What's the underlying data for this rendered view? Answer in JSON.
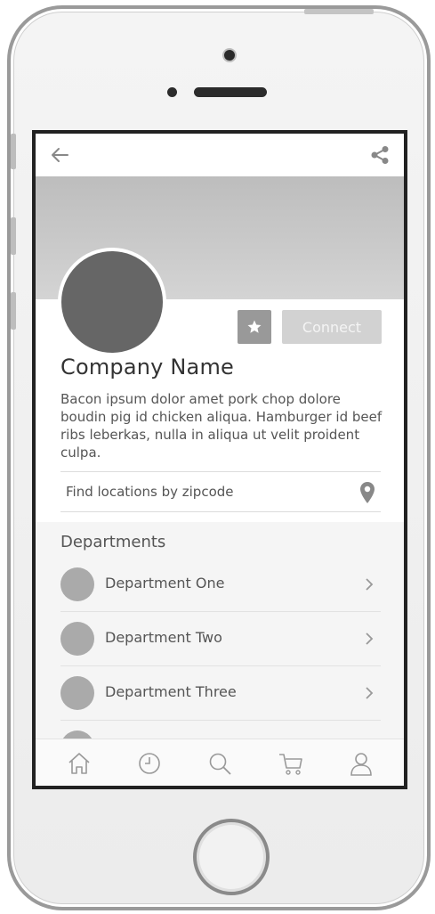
{
  "header": {
    "back_icon": "arrow-left-icon",
    "share_icon": "share-icon"
  },
  "profile": {
    "company_name": "Company Name",
    "description": "Bacon ipsum dolor amet pork chop dolore boudin pig id chicken aliqua. Hamburger id beef ribs leberkas, nulla in aliqua ut velit proident culpa.",
    "favorite_icon": "star-icon",
    "connect_label": "Connect"
  },
  "search": {
    "placeholder": "Find locations by zipcode",
    "icon": "map-pin-icon"
  },
  "departments": {
    "title": "Departments",
    "items": [
      {
        "label": "Department One"
      },
      {
        "label": "Department Two"
      },
      {
        "label": "Department Three"
      }
    ]
  },
  "bottom_nav": {
    "items": [
      {
        "icon": "home-icon"
      },
      {
        "icon": "clock-icon"
      },
      {
        "icon": "search-icon"
      },
      {
        "icon": "cart-icon"
      },
      {
        "icon": "user-icon"
      }
    ]
  },
  "colors": {
    "banner": "#c8c8c8",
    "avatar": "#666666",
    "favorite_button": "#999999",
    "connect_button": "#d2d2d2"
  }
}
